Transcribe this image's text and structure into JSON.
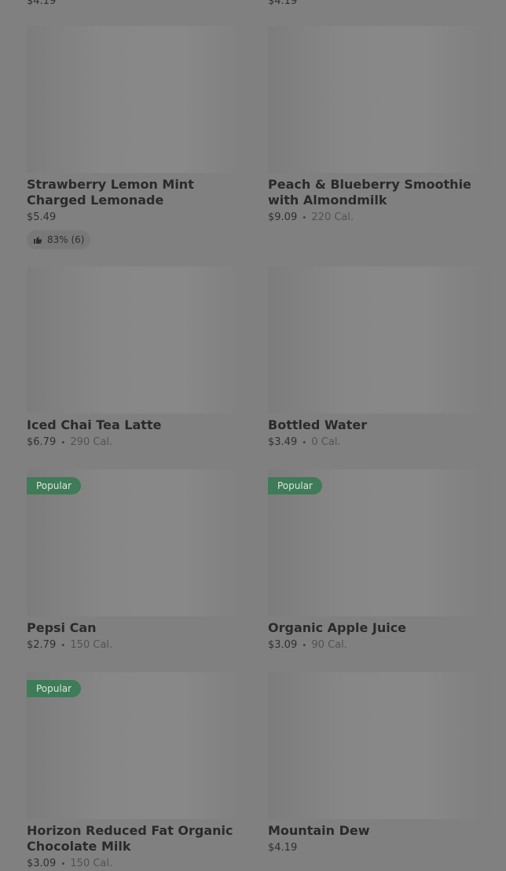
{
  "top": {
    "left_price": "$4.19",
    "right_price": "$4.19"
  },
  "items": [
    {
      "name": "Strawberry Lemon Mint Charged Lemonade",
      "price": "$5.49",
      "rating": "83% (6)"
    },
    {
      "name": "Peach & Blueberry Smoothie with Almondmilk",
      "price": "$9.09",
      "cal": "220 Cal."
    },
    {
      "name": "Iced Chai Tea Latte",
      "price": "$6.79",
      "cal": "290 Cal."
    },
    {
      "name": "Bottled Water",
      "price": "$3.49",
      "cal": "0 Cal."
    },
    {
      "name": "Pepsi Can",
      "price": "$2.79",
      "cal": "150 Cal.",
      "badge": "Popular"
    },
    {
      "name": "Organic Apple Juice",
      "price": "$3.09",
      "cal": "90 Cal.",
      "badge": "Popular"
    },
    {
      "name": "Horizon Reduced Fat Organic Chocolate Milk",
      "price": "$3.09",
      "cal": "150 Cal.",
      "badge": "Popular"
    },
    {
      "name": "Mountain Dew",
      "price": "$4.19"
    }
  ],
  "separator": "•",
  "icons": {
    "rating": "thumbs-up-icon"
  }
}
